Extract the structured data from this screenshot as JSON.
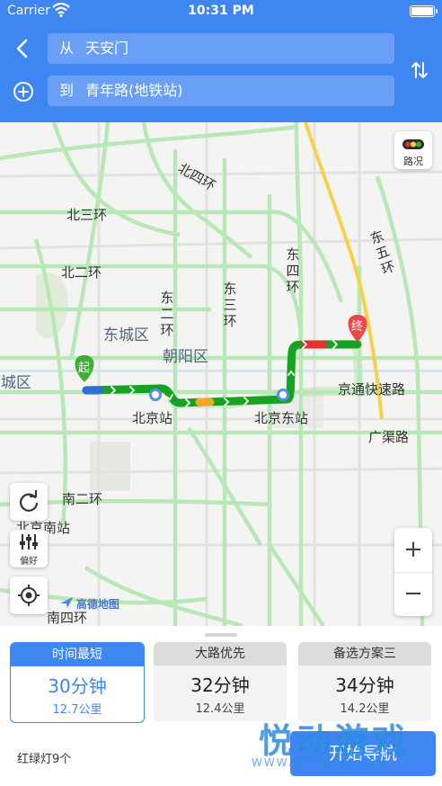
{
  "status_bar": {
    "carrier": "Carrier",
    "time": "10:31 PM"
  },
  "search": {
    "from_prefix": "从",
    "from_value": "天安门",
    "to_prefix": "到",
    "to_value": "青年路(地铁站)"
  },
  "map": {
    "traffic_label": "路况",
    "preference_label": "偏好",
    "zoom_in": "+",
    "zoom_out": "−",
    "start_marker": "起",
    "end_marker": "终",
    "logo": "高德地图",
    "ring_roads": {
      "north4": "北四环",
      "north3": "北三环",
      "north2": "北二环",
      "east4": "东四环",
      "east5": "东五环",
      "east3": "东三环",
      "east2": "东二环",
      "south2": "南二环",
      "south4": "南四环"
    },
    "districts": {
      "dongcheng": "东城区",
      "chaoyang": "朝阳区",
      "xicheng": "西城区"
    },
    "places": {
      "beijing_station": "北京站",
      "beijing_east_station": "北京东站",
      "jingtong": "京通快速路",
      "guangqu": "广渠路",
      "beijing_south": "北京南站"
    }
  },
  "routes": [
    {
      "title": "时间最短",
      "time": "30分钟",
      "distance": "12.7公里",
      "selected": true
    },
    {
      "title": "大路优先",
      "time": "32分钟",
      "distance": "12.4公里",
      "selected": false
    },
    {
      "title": "备选方案三",
      "time": "34分钟",
      "distance": "14.2公里",
      "selected": false
    }
  ],
  "traffic_lights": "红绿灯9个",
  "start_button": "开始导航",
  "watermark": {
    "title": "悦动游戏",
    "url": "WWW.MYDONG.COM"
  },
  "colors": {
    "primary": "#3f86f3",
    "route_green": "#16a324",
    "road_green": "#b9e8b7",
    "road_yellow": "#f5d24a",
    "traffic_red": "#e33232",
    "marker_red": "#e84a4a",
    "marker_green": "#3fae34"
  }
}
